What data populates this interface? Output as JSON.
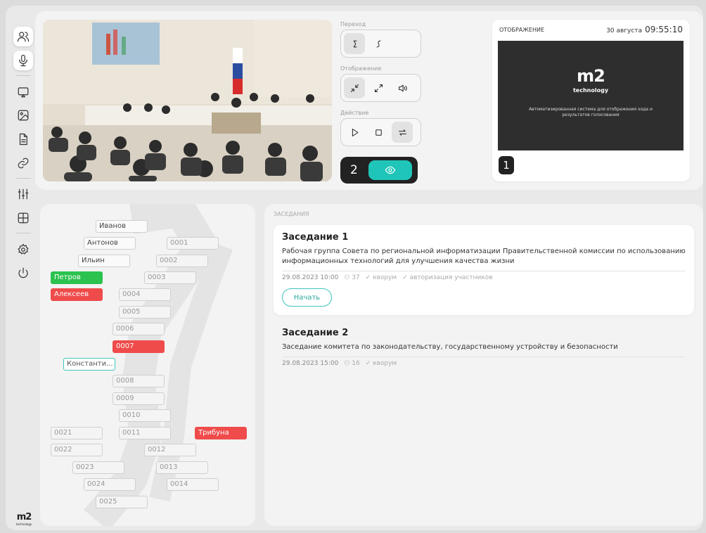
{
  "display": {
    "header": "ОТОБРАЖЕНИЕ",
    "date": "30 августа",
    "time": "09:55:10",
    "logo": "m2",
    "logo_sub": "technology",
    "description": "Автоматизированная система для отображения хода и результатов голосования",
    "screen_number": "1"
  },
  "controls": {
    "transition_label": "Переход",
    "display_label": "Отображение",
    "action_label": "Действие",
    "screen2_number": "2"
  },
  "sidebar": {
    "logo": "m2",
    "logo_sub": "technology"
  },
  "seats": [
    {
      "label": "Иванов",
      "kind": "person"
    },
    {
      "label": "Антонов",
      "kind": "person"
    },
    {
      "label": "0001",
      "kind": "empty"
    },
    {
      "label": "Ильин",
      "kind": "person"
    },
    {
      "label": "0002",
      "kind": "empty"
    },
    {
      "label": "Петров",
      "kind": "green"
    },
    {
      "label": "0003",
      "kind": "empty"
    },
    {
      "label": "Алексеев",
      "kind": "red"
    },
    {
      "label": "0004",
      "kind": "empty"
    },
    {
      "label": "0005",
      "kind": "empty"
    },
    {
      "label": "0006",
      "kind": "empty"
    },
    {
      "label": "0007",
      "kind": "red"
    },
    {
      "label": "Константи...",
      "kind": "teal"
    },
    {
      "label": "0008",
      "kind": "empty"
    },
    {
      "label": "0009",
      "kind": "empty"
    },
    {
      "label": "0010",
      "kind": "empty"
    },
    {
      "label": "0021",
      "kind": "empty"
    },
    {
      "label": "0011",
      "kind": "empty"
    },
    {
      "label": "Трибуна",
      "kind": "red"
    },
    {
      "label": "0022",
      "kind": "empty"
    },
    {
      "label": "0012",
      "kind": "empty"
    },
    {
      "label": "0023",
      "kind": "empty"
    },
    {
      "label": "0013",
      "kind": "empty"
    },
    {
      "label": "0024",
      "kind": "empty"
    },
    {
      "label": "0014",
      "kind": "empty"
    },
    {
      "label": "0025",
      "kind": "empty"
    }
  ],
  "sessions": {
    "title": "ЗАСЕДАНИЯ",
    "items": [
      {
        "name": "Заседание 1",
        "description": "Рабочая группа Совета по региональной информатизации Правительственной комиссии по использованию информационных технологий для улучшения качества жизни",
        "datetime": "29.08.2023 10:00",
        "participants": "37",
        "quorum": "кворум",
        "auth": "авторизация участников",
        "start_label": "Начать"
      },
      {
        "name": "Заседание 2",
        "description": "Заседание комитета по законодательству, государственному устройству и безопасности",
        "datetime": "29.08.2023 15:00",
        "participants": "16",
        "quorum": "кворум"
      }
    ]
  },
  "colors": {
    "accent": "#1fc5b8",
    "green": "#2bc24f",
    "red": "#ef4b4b"
  }
}
